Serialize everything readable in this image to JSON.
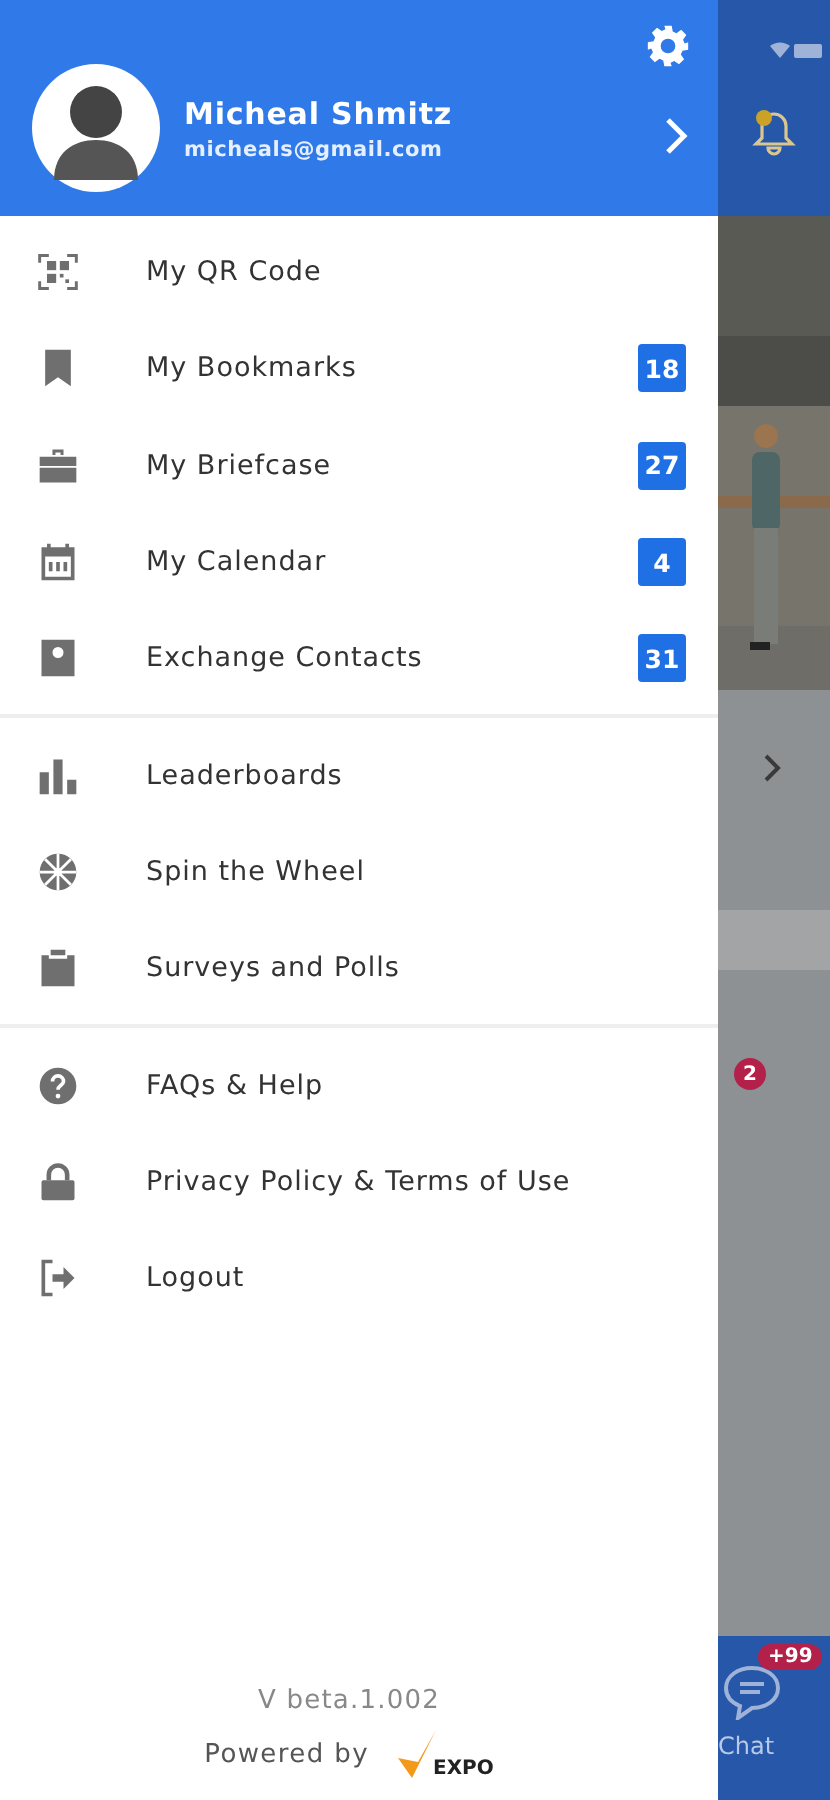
{
  "drawer": {
    "profile": {
      "name": "Micheal Shmitz",
      "email": "micheals@gmail.com"
    },
    "sections": [
      {
        "items": [
          {
            "kind": "qr",
            "label": "My QR Code"
          },
          {
            "kind": "bookmark",
            "label": "My Bookmarks",
            "badge": "18"
          },
          {
            "kind": "briefcase",
            "label": "My Briefcase",
            "badge": "27"
          },
          {
            "kind": "calendar",
            "label": "My Calendar",
            "badge": "4"
          },
          {
            "kind": "contact",
            "label": "Exchange Contacts",
            "badge": "31"
          }
        ]
      },
      {
        "items": [
          {
            "kind": "chart",
            "label": "Leaderboards"
          },
          {
            "kind": "wheel",
            "label": "Spin the Wheel"
          },
          {
            "kind": "clipboard",
            "label": "Surveys and Polls"
          }
        ]
      },
      {
        "items": [
          {
            "kind": "help",
            "label": "FAQs & Help"
          },
          {
            "kind": "lock",
            "label": "Privacy Policy & Terms of Use"
          },
          {
            "kind": "logout",
            "label": "Logout"
          }
        ]
      }
    ],
    "footer": {
      "version": "V beta.1.002",
      "powered_by": "Powered by",
      "logo": "EXPO"
    }
  },
  "background": {
    "badge": "2",
    "chat": {
      "label": "Chat",
      "badge": "+99"
    }
  }
}
